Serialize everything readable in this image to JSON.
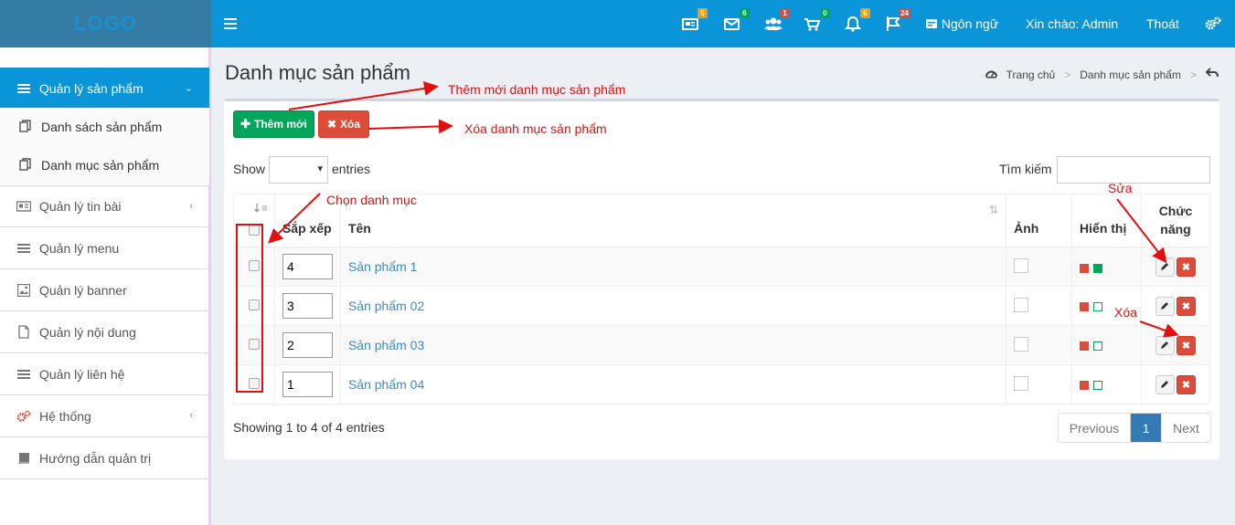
{
  "header": {
    "logo": "LOGO",
    "badges": [
      {
        "icon": "newspaper-icon",
        "count": "5",
        "color": "#f39c12"
      },
      {
        "icon": "envelope-icon",
        "count": "6",
        "color": "#00a65a"
      },
      {
        "icon": "users-icon",
        "count": "1",
        "color": "#dd4b39"
      },
      {
        "icon": "cart-icon",
        "count": "0",
        "color": "#00a65a"
      },
      {
        "icon": "bell-icon",
        "count": "6",
        "color": "#f39c12"
      },
      {
        "icon": "flag-icon",
        "count": "24",
        "color": "#dd4b39"
      }
    ],
    "language": "Ngôn ngữ",
    "greeting": "Xin chào: Admin",
    "logout": "Thoát"
  },
  "sidebar": {
    "items": [
      {
        "label": "Quản lý sản phẩm",
        "icon": "bars-icon"
      },
      {
        "label": "Quản lý tin bài",
        "icon": "newspaper-icon"
      },
      {
        "label": "Quản lý menu",
        "icon": "bars-icon"
      },
      {
        "label": "Quản lý banner",
        "icon": "image-icon"
      },
      {
        "label": "Quản lý nội dung",
        "icon": "file-icon"
      },
      {
        "label": "Quản lý liên hệ",
        "icon": "bars-icon"
      },
      {
        "label": "Hệ thống",
        "icon": "gears-icon"
      },
      {
        "label": "Hướng dẫn quản trị",
        "icon": "book-icon"
      }
    ],
    "sub_items": [
      {
        "label": "Danh sách sản phẩm"
      },
      {
        "label": "Danh mục sản phẩm"
      }
    ]
  },
  "page": {
    "title": "Danh mục sản phẩm",
    "breadcrumb": {
      "home": "Trang chủ",
      "current": "Danh mục sản phẩm"
    }
  },
  "toolbar": {
    "add_label": "Thêm mới",
    "delete_label": "Xóa"
  },
  "table_controls": {
    "show": "Show",
    "entries": "entries",
    "search_label": "Tìm kiếm"
  },
  "table": {
    "headers": {
      "order": "Sắp xếp",
      "name": "Tên",
      "image": "Ảnh",
      "display": "Hiển thị",
      "func_line1": "Chức",
      "func_line2": "năng"
    },
    "rows": [
      {
        "order": "4",
        "name": "Sản phẩm 1",
        "display_active": true
      },
      {
        "order": "3",
        "name": "Sản phẩm 02",
        "display_active": false
      },
      {
        "order": "2",
        "name": "Sản phẩm 03",
        "display_active": false
      },
      {
        "order": "1",
        "name": "Sản phẩm 04",
        "display_active": false
      }
    ]
  },
  "footer": {
    "info": "Showing 1 to 4 of 4 entries",
    "previous": "Previous",
    "page": "1",
    "next": "Next"
  },
  "annotations": {
    "add": "Thêm mới danh mục sản phẩm",
    "delete": "Xóa danh mục sản phẩm",
    "select": "Chọn danh mục",
    "edit": "Sửa",
    "row_delete": "Xóa"
  },
  "colors": {
    "primary": "#0b95d9",
    "success": "#00a65a",
    "danger": "#dd4b39",
    "annotation": "#e01010"
  }
}
